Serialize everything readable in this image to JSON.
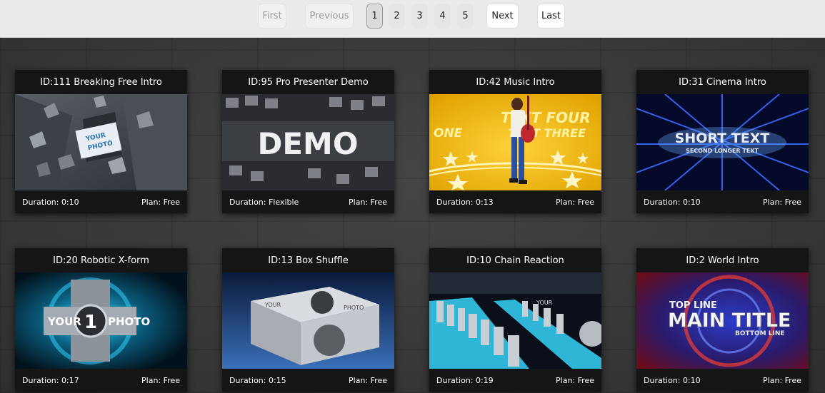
{
  "pagination": {
    "first": "First",
    "previous": "Previous",
    "pages": [
      "1",
      "2",
      "3",
      "4",
      "5"
    ],
    "current": "1",
    "next": "Next",
    "last": "Last"
  },
  "videos": [
    {
      "title": "ID:111 Breaking Free Intro",
      "duration": "Duration: 0:10",
      "plan": "Plan: Free",
      "thumb_text": [
        "YOUR",
        "PHOTO"
      ]
    },
    {
      "title": "ID:95 Pro Presenter Demo",
      "duration": "Duration: Flexible",
      "plan": "Plan: Free",
      "thumb_text": [
        "DEMO"
      ]
    },
    {
      "title": "ID:42 Music Intro",
      "duration": "Duration: 0:13",
      "plan": "Plan: Free",
      "thumb_text": [
        "ONE",
        "TEXT FOUR",
        "TEXT THREE"
      ]
    },
    {
      "title": "ID:31 Cinema Intro",
      "duration": "Duration: 0:10",
      "plan": "Plan: Free",
      "thumb_text": [
        "SHORT TEXT",
        "SECOND LONGER TEXT"
      ]
    },
    {
      "title": "ID:20 Robotic X-form",
      "duration": "Duration: 0:17",
      "plan": "Plan: Free",
      "thumb_text": [
        "YOUR",
        "1",
        "PHOTO"
      ]
    },
    {
      "title": "ID:13 Box Shuffle",
      "duration": "Duration: 0:15",
      "plan": "Plan: Free",
      "thumb_text": [
        "YOUR",
        "PHOTO"
      ]
    },
    {
      "title": "ID:10 Chain Reaction",
      "duration": "Duration: 0:19",
      "plan": "Plan: Free",
      "thumb_text": [
        "YOUR"
      ]
    },
    {
      "title": "ID:2 World Intro",
      "duration": "Duration: 0:10",
      "plan": "Plan: Free",
      "thumb_text": [
        "TOP LINE",
        "MAIN TITLE",
        "BOTTOM LINE"
      ]
    }
  ]
}
